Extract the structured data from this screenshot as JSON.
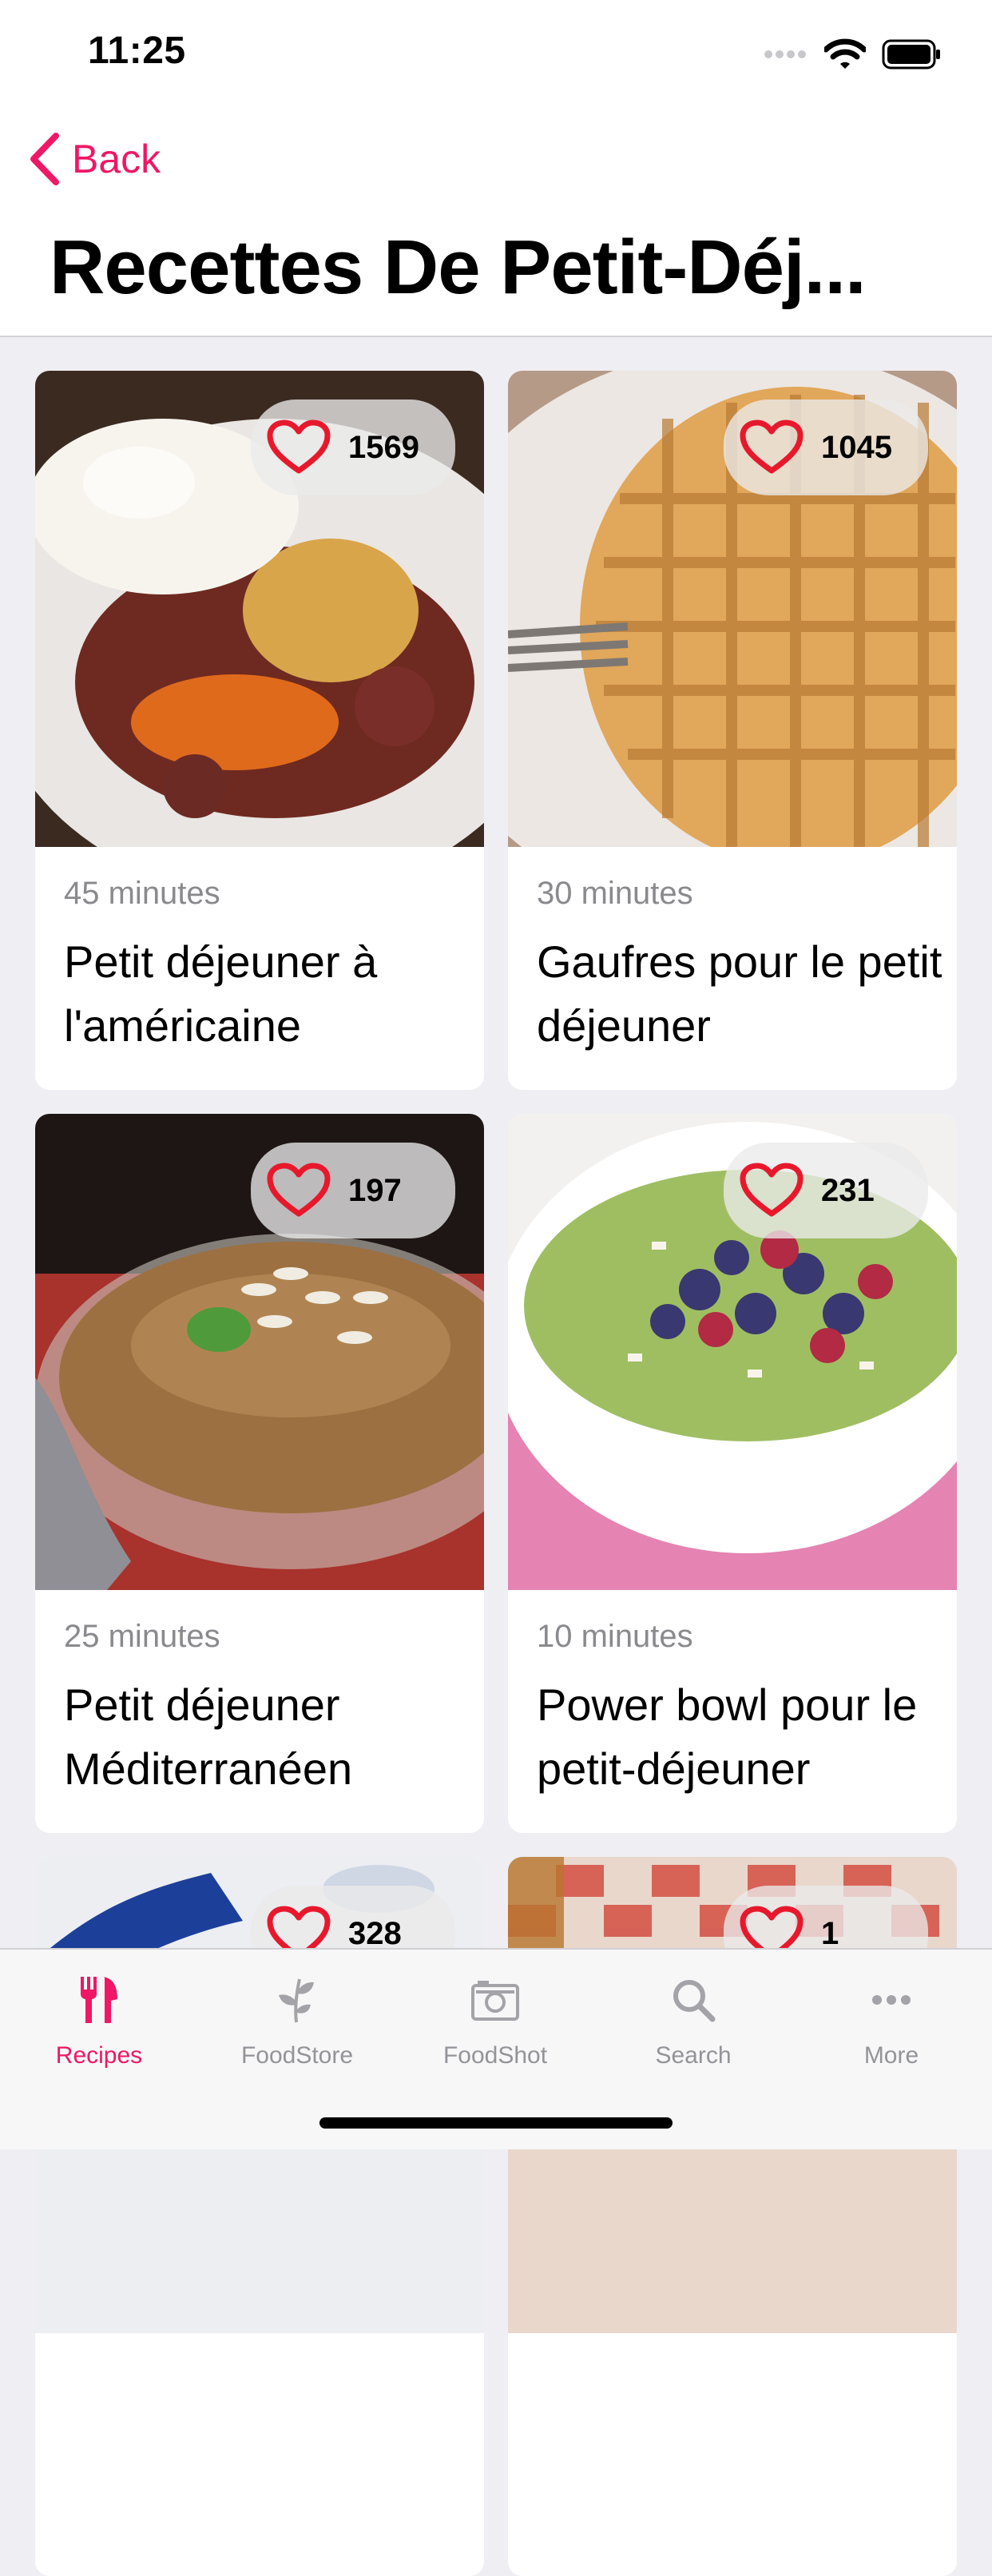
{
  "status_bar": {
    "time": "11:25"
  },
  "nav": {
    "back_label": "Back",
    "title": "Recettes De Petit-Déj..."
  },
  "colors": {
    "accent": "#ef1766",
    "heart": "#e8182c",
    "inactive": "#939399"
  },
  "recipes": [
    {
      "likes": "1569",
      "time": "45 minutes",
      "title": "Petit déjeuner à l'américaine"
    },
    {
      "likes": "1045",
      "time": "30 minutes",
      "title": "Gaufres pour le petit déjeuner"
    },
    {
      "likes": "197",
      "time": "25 minutes",
      "title": "Petit déjeuner Méditerranéen"
    },
    {
      "likes": "231",
      "time": "10 minutes",
      "title": "Power bowl pour le petit-déjeuner"
    },
    {
      "likes": "328",
      "time": "",
      "title": ""
    },
    {
      "likes": "1",
      "time": "",
      "title": ""
    }
  ],
  "tabs": [
    {
      "label": "Recipes",
      "icon": "fork-knife-icon",
      "active": true
    },
    {
      "label": "FoodStore",
      "icon": "leaf-icon",
      "active": false
    },
    {
      "label": "FoodShot",
      "icon": "camera-icon",
      "active": false
    },
    {
      "label": "Search",
      "icon": "search-icon",
      "active": false
    },
    {
      "label": "More",
      "icon": "more-dots-icon",
      "active": false
    }
  ]
}
